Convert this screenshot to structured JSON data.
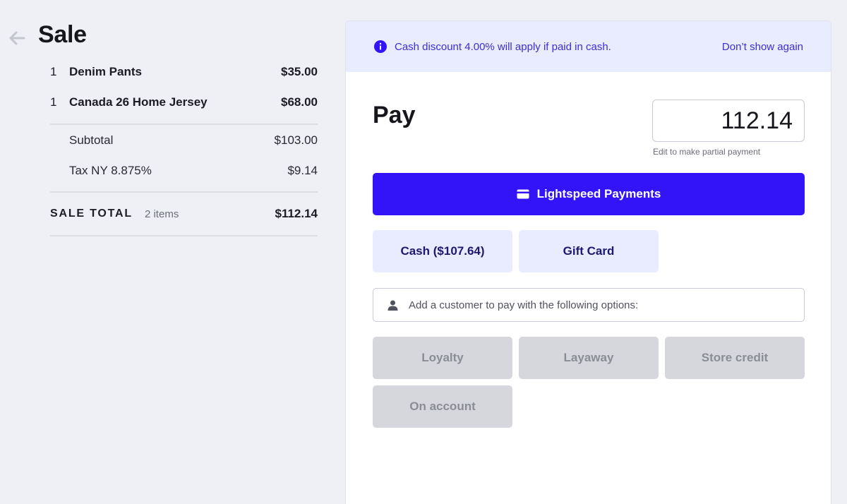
{
  "sale": {
    "title": "Sale",
    "items": [
      {
        "qty": "1",
        "name": "Denim Pants",
        "price": "$35.00"
      },
      {
        "qty": "1",
        "name": "Canada 26 Home Jersey",
        "price": "$68.00"
      }
    ],
    "subtotal_label": "Subtotal",
    "subtotal": "$103.00",
    "tax_label": "Tax NY 8.875%",
    "tax": "$9.14",
    "total_label": "SALE TOTAL",
    "item_count": "2 items",
    "total": "$112.14"
  },
  "notice": {
    "text": "Cash discount 4.00% will apply if paid in cash.",
    "dismiss_label": "Don’t show again"
  },
  "pay": {
    "title": "Pay",
    "amount": "112.14",
    "amount_hint": "Edit to make partial payment",
    "primary_label": "Lightspeed Payments",
    "methods": [
      "Cash ($107.64)",
      "Gift Card"
    ],
    "customer_placeholder": "Add a customer to pay with the following options:",
    "customer_options": [
      "Loyalty",
      "Layaway",
      "Store credit",
      "On account"
    ]
  },
  "colors": {
    "accent": "#3314f8",
    "notice_bg": "#e9ebff",
    "notice_text": "#3b2fd6",
    "disabled_bg": "#d6d7dc"
  }
}
